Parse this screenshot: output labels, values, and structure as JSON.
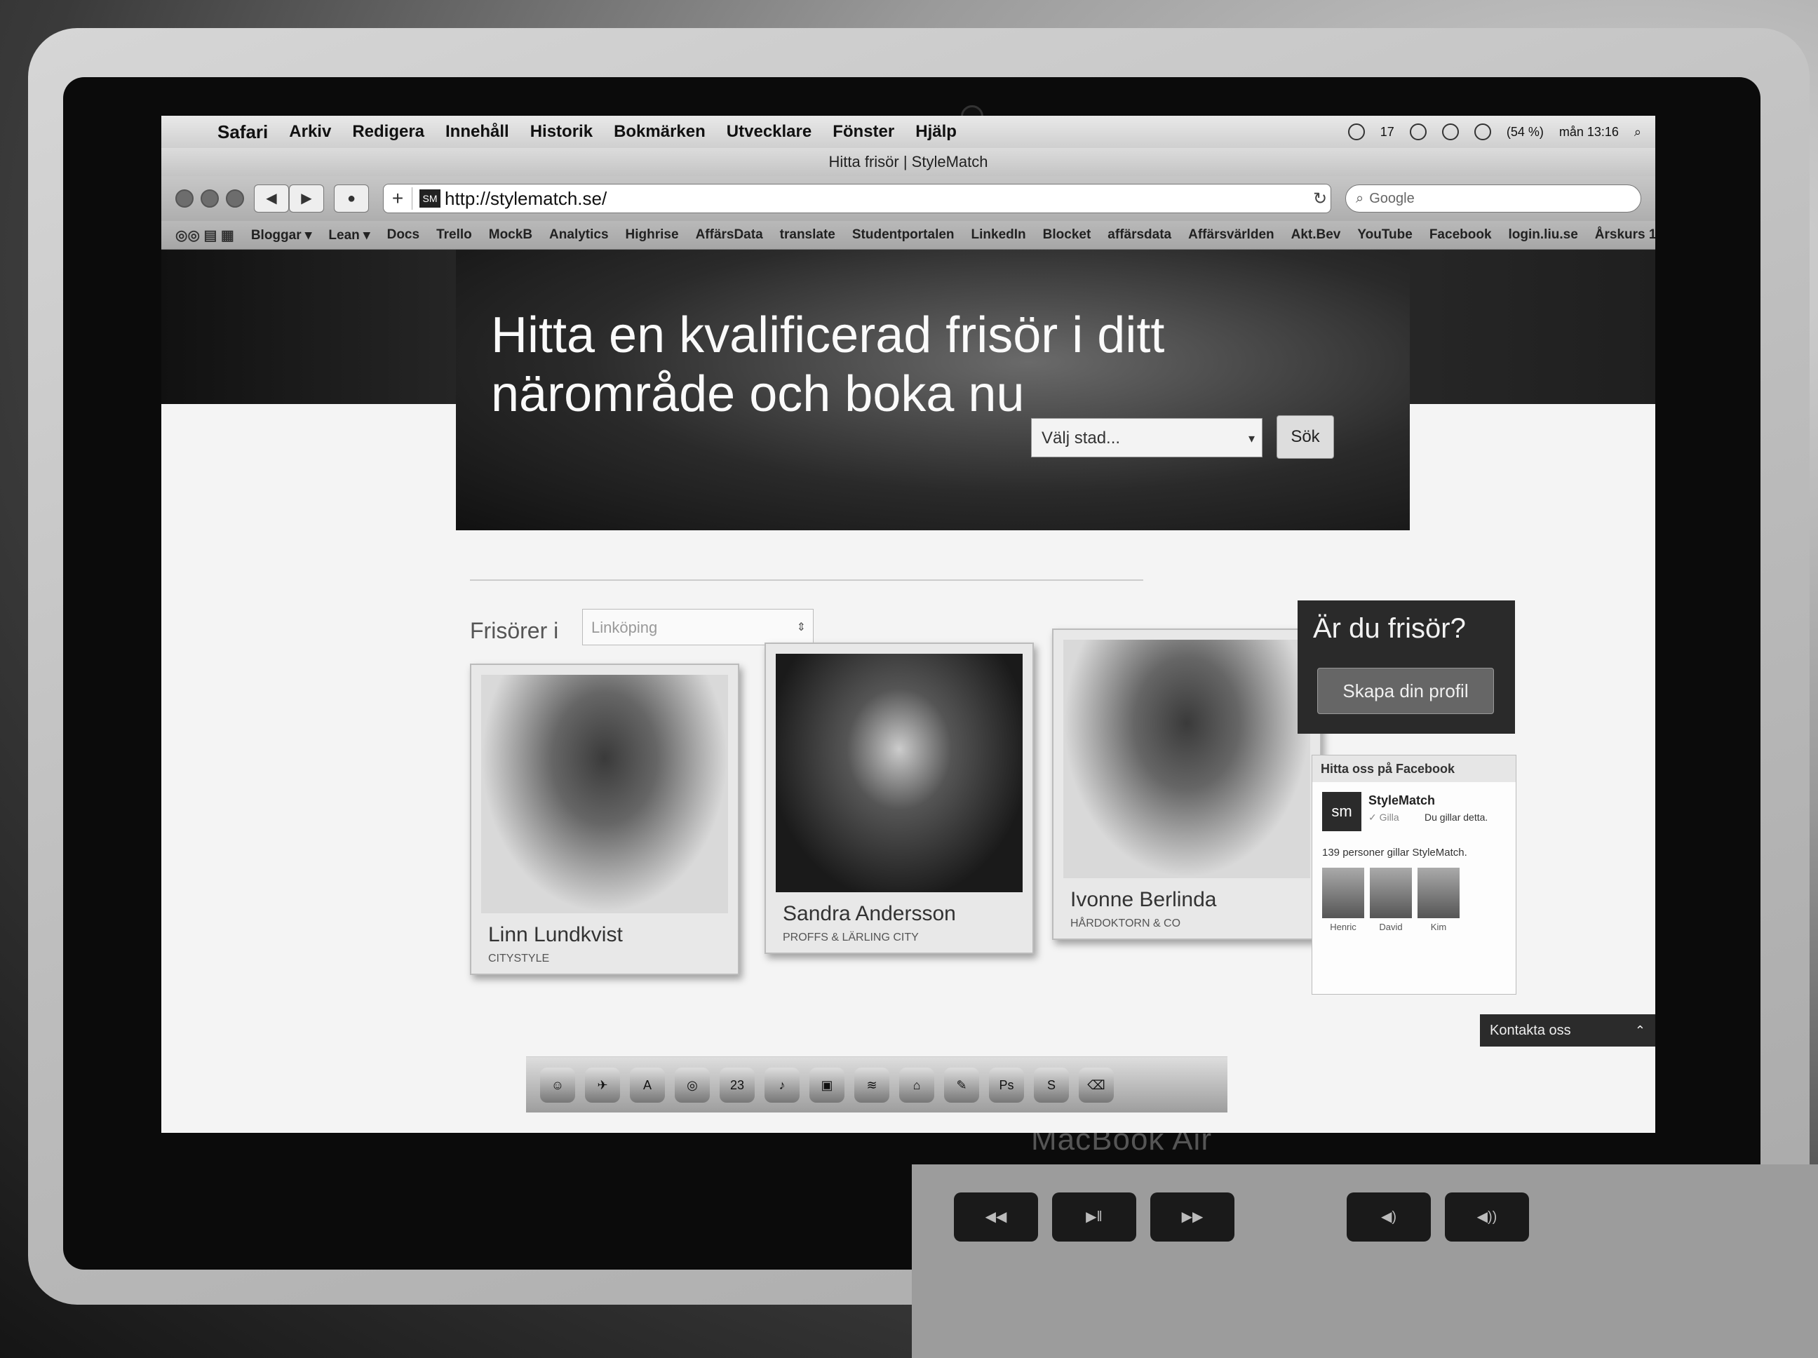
{
  "menubar": {
    "app": "Safari",
    "items": [
      "Arkiv",
      "Redigera",
      "Innehåll",
      "Historik",
      "Bokmärken",
      "Utvecklare",
      "Fönster",
      "Hjälp"
    ],
    "status": {
      "notification_count": "17",
      "battery": "(54 %)",
      "clock": "mån 13:16"
    }
  },
  "window": {
    "title": "Hitta frisör | StyleMatch"
  },
  "toolbar": {
    "url": "http://stylematch.se/",
    "favicon_text": "SM",
    "search_placeholder": "Google"
  },
  "bookmarks": [
    "Bloggar ▾",
    "Lean ▾",
    "Docs",
    "Trello",
    "MockB",
    "Analytics",
    "Highrise",
    "AffärsData",
    "translate",
    "Studentportalen",
    "LinkedIn",
    "Blocket",
    "affärsdata",
    "Affärsvärlden",
    "Akt.Bev",
    "YouTube",
    "Facebook",
    "login.liu.se",
    "Årskurs 1"
  ],
  "hero": {
    "title": "Hitta en kvalificerad frisör i ditt närområde och boka nu",
    "city_placeholder": "Välj stad...",
    "search_label": "Sök"
  },
  "listing": {
    "label": "Frisörer i",
    "city": "Linköping",
    "stylists": [
      {
        "name": "Linn Lundkvist",
        "salon": "CITYSTYLE"
      },
      {
        "name": "Sandra Andersson",
        "salon": "PROFFS & LÄRLING CITY"
      },
      {
        "name": "Ivonne Berlinda",
        "salon": "HÅRDOKTORN & CO"
      }
    ]
  },
  "cta": {
    "question": "Är du frisör?",
    "button": "Skapa din profil"
  },
  "facebook": {
    "title": "Hitta oss på Facebook",
    "page_name": "StyleMatch",
    "logo_text": "sm",
    "like_label": "✓ Gilla",
    "you_like": "Du gillar detta.",
    "count_text": "139 personer gillar StyleMatch.",
    "faces": [
      "Henric",
      "David",
      "Kim"
    ]
  },
  "contact": {
    "label": "Kontakta oss"
  },
  "laptop": {
    "brand": "MacBook Air"
  },
  "dock": {
    "calendar_day": "23"
  }
}
